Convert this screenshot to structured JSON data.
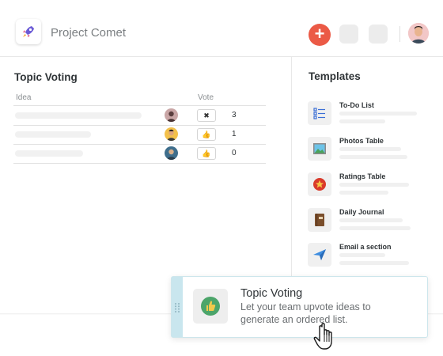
{
  "header": {
    "app_title": "Project Comet",
    "app_icon": "rocket-icon",
    "add_label": "+",
    "accent_color": "#eb5a46"
  },
  "topic_voting": {
    "title": "Topic Voting",
    "columns": {
      "idea": "Idea",
      "vote": "Vote"
    },
    "rows": [
      {
        "vote_icon": "✖",
        "count": "3"
      },
      {
        "vote_icon": "👍",
        "count": "1"
      },
      {
        "vote_icon": "👍",
        "count": "0"
      }
    ]
  },
  "templates": {
    "title": "Templates",
    "items": [
      {
        "label": "To-Do List",
        "icon": "checklist-icon"
      },
      {
        "label": "Photos Table",
        "icon": "photo-icon"
      },
      {
        "label": "Ratings Table",
        "icon": "star-icon"
      },
      {
        "label": "Daily Journal",
        "icon": "journal-icon"
      },
      {
        "label": "Email a section",
        "icon": "paper-plane-icon"
      }
    ]
  },
  "drag_card": {
    "title": "Topic Voting",
    "description": "Let your team upvote ideas to generate an ordered list.",
    "icon": "thumbs-up-icon"
  }
}
